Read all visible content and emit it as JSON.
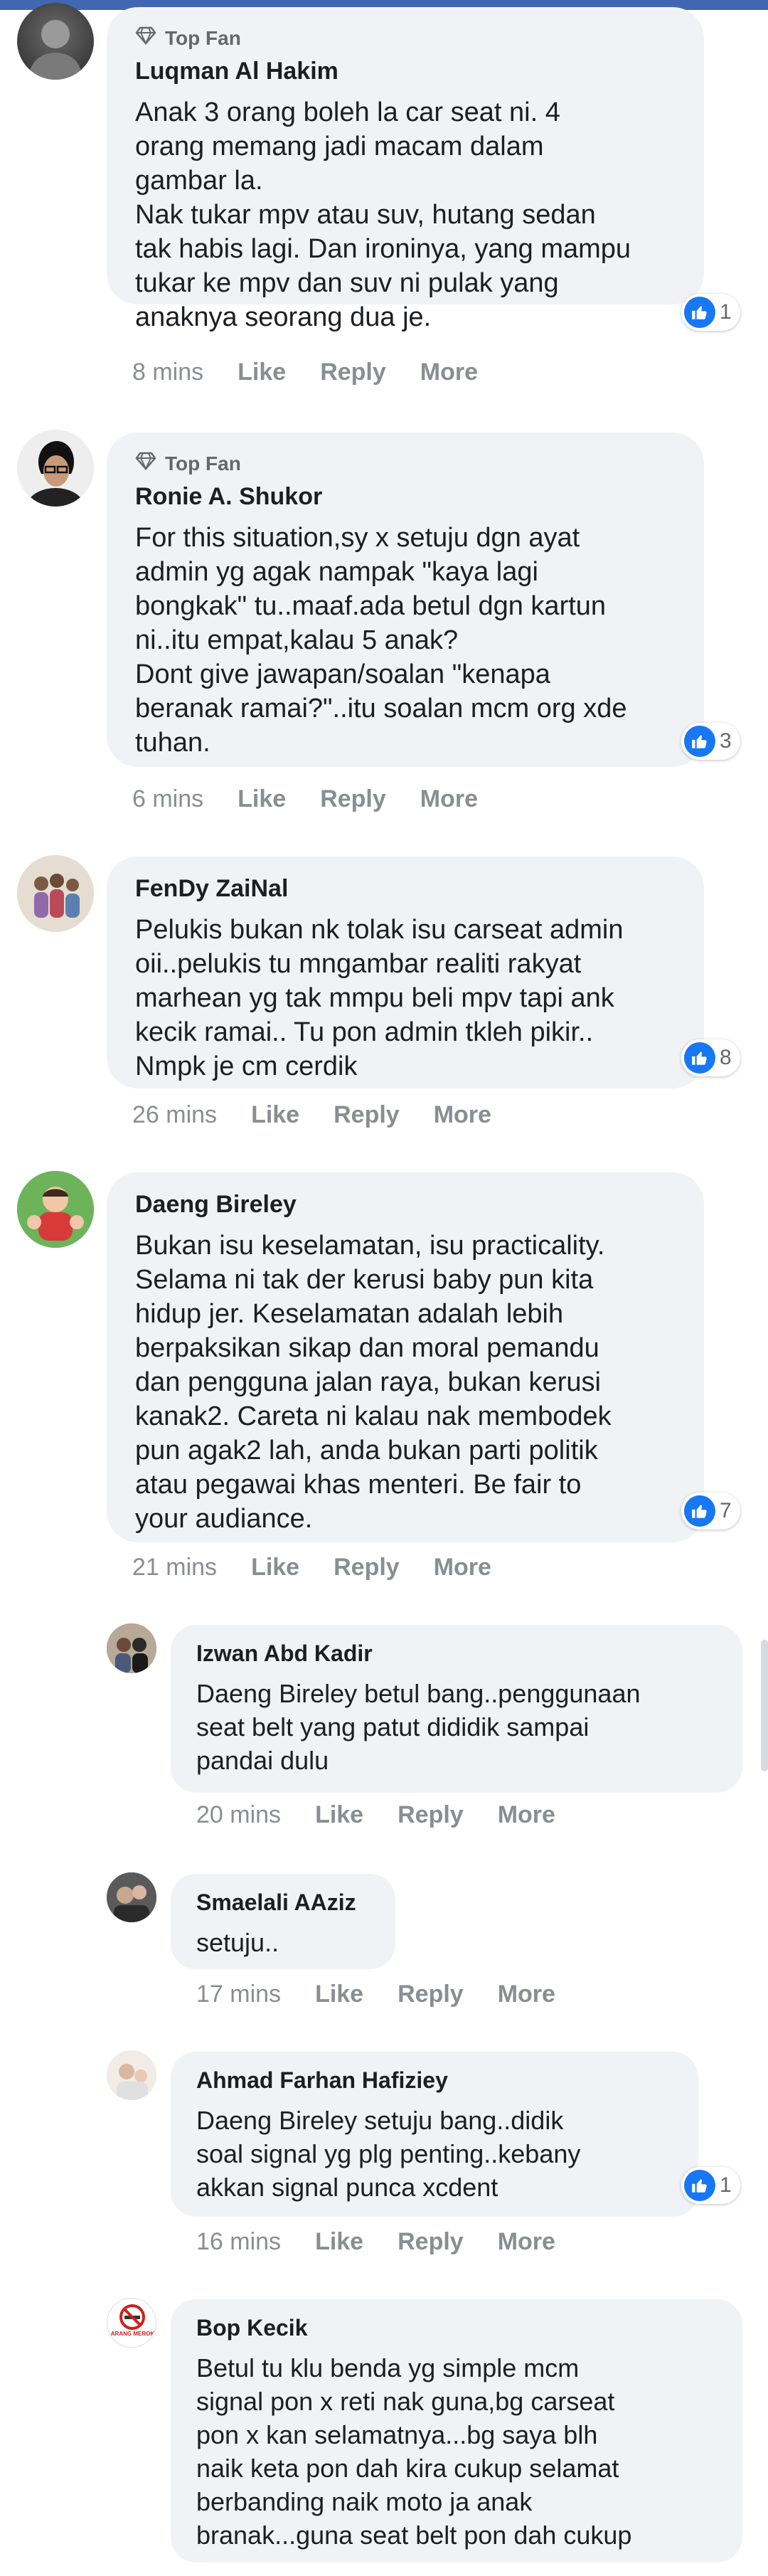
{
  "theme": {
    "bubble": "#f0f2f5",
    "like_blue": "#1877f2",
    "meta_gray": "#8a8d91"
  },
  "comments": [
    {
      "badge": "Top Fan",
      "author": "Luqman Al Hakim",
      "text": "Anak 3 orang boleh la car seat ni. 4\norang memang jadi macam dalam\ngambar la.\nNak tukar mpv atau suv, hutang sedan\ntak habis lagi. Dan ironinya, yang mampu\ntukar ke mpv dan suv ni pulak yang\nanaknya seorang dua je.",
      "reactions": "1",
      "time": "8 mins",
      "like": "Like",
      "reply": "Reply",
      "more": "More"
    },
    {
      "badge": "Top Fan",
      "author": "Ronie A. Shukor",
      "text": "For this situation,sy x setuju dgn ayat\nadmin yg agak nampak \"kaya lagi\nbongkak\" tu..maaf.ada betul dgn kartun\nni..itu empat,kalau 5 anak?\nDont give jawapan/soalan \"kenapa\nberanak ramai?\"..itu soalan mcm org xde\ntuhan.",
      "reactions": "3",
      "time": "6 mins",
      "like": "Like",
      "reply": "Reply",
      "more": "More"
    },
    {
      "author": "FenDy ZaiNal",
      "text": "Pelukis bukan nk tolak isu carseat admin\noii..pelukis tu mngambar realiti rakyat\nmarhean yg tak mmpu beli mpv tapi ank\nkecik ramai.. Tu pon admin tkleh pikir..\nNmpk je cm cerdik",
      "reactions": "8",
      "time": "26 mins",
      "like": "Like",
      "reply": "Reply",
      "more": "More"
    },
    {
      "author": "Daeng Bireley",
      "text": "Bukan isu keselamatan, isu practicality.\nSelama ni tak der kerusi baby pun kita\nhidup jer. Keselamatan adalah lebih\nberpaksikan sikap dan moral pemandu\ndan pengguna jalan raya, bukan kerusi\nkanak2. Careta ni kalau nak membodek\npun agak2 lah, anda bukan parti politik\natau pegawai khas menteri. Be fair to\nyour audiance.",
      "reactions": "7",
      "time": "21 mins",
      "like": "Like",
      "reply": "Reply",
      "more": "More"
    }
  ],
  "replies": [
    {
      "author": "Izwan Abd Kadir",
      "text": "Daeng Bireley betul bang..penggunaan\nseat belt yang patut dididik sampai\npandai dulu",
      "time": "20 mins",
      "like": "Like",
      "reply": "Reply",
      "more": "More"
    },
    {
      "author": "Smaelali AAziz",
      "text": "setuju..",
      "time": "17 mins",
      "like": "Like",
      "reply": "Reply",
      "more": "More"
    },
    {
      "author": "Ahmad Farhan Hafiziey",
      "text": "Daeng Bireley setuju bang..didik\nsoal signal yg plg penting..kebany\nakkan signal punca xcdent",
      "reactions": "1",
      "time": "16 mins",
      "like": "Like",
      "reply": "Reply",
      "more": "More"
    },
    {
      "author": "Bop Kecik",
      "avatar_sign": "DILARANG MEROKOK",
      "text": "Betul tu klu benda yg simple mcm\nsignal pon x reti nak guna,bg carseat\npon x kan selamatnya...bg saya blh\nnaik keta pon dah kira cukup selamat\nberbanding naik moto ja anak\nbranak...guna seat belt pon dah cukup"
    }
  ]
}
